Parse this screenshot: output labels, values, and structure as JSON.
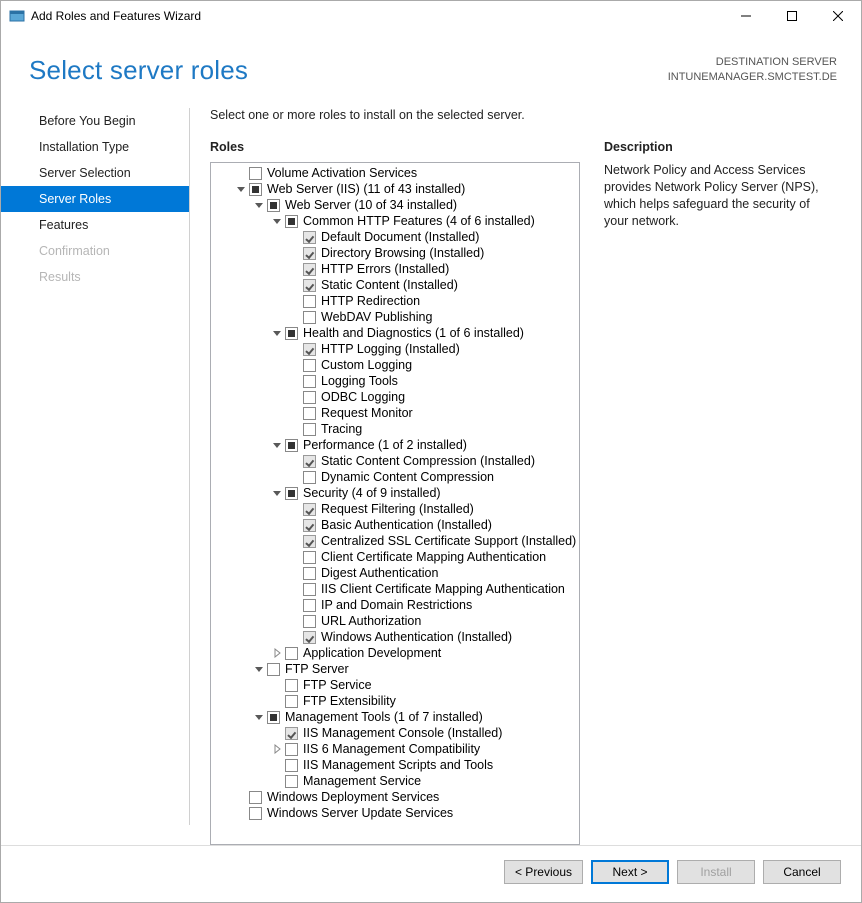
{
  "window": {
    "title": "Add Roles and Features Wizard"
  },
  "header": {
    "page_title": "Select server roles",
    "dest_label": "DESTINATION SERVER",
    "dest_value": "INTUNEMANAGER.SMCTEST.DE"
  },
  "nav": {
    "items": [
      {
        "label": "Before You Begin",
        "state": "normal"
      },
      {
        "label": "Installation Type",
        "state": "normal"
      },
      {
        "label": "Server Selection",
        "state": "normal"
      },
      {
        "label": "Server Roles",
        "state": "selected"
      },
      {
        "label": "Features",
        "state": "normal"
      },
      {
        "label": "Confirmation",
        "state": "disabled"
      },
      {
        "label": "Results",
        "state": "disabled"
      }
    ]
  },
  "content": {
    "instruction": "Select one or more roles to install on the selected server.",
    "roles_label": "Roles",
    "desc_label": "Description",
    "desc_text": "Network Policy and Access Services provides Network Policy Server (NPS), which helps safeguard the security of your network."
  },
  "tree": [
    {
      "d": 1,
      "t": "none",
      "c": "unchecked",
      "l": "Volume Activation Services"
    },
    {
      "d": 1,
      "t": "open",
      "c": "partial",
      "l": "Web Server (IIS) (11 of 43 installed)"
    },
    {
      "d": 2,
      "t": "open",
      "c": "partial",
      "l": "Web Server (10 of 34 installed)"
    },
    {
      "d": 3,
      "t": "open",
      "c": "partial",
      "l": "Common HTTP Features (4 of 6 installed)"
    },
    {
      "d": 4,
      "t": "none",
      "c": "checked",
      "l": "Default Document (Installed)"
    },
    {
      "d": 4,
      "t": "none",
      "c": "checked",
      "l": "Directory Browsing (Installed)"
    },
    {
      "d": 4,
      "t": "none",
      "c": "checked",
      "l": "HTTP Errors (Installed)"
    },
    {
      "d": 4,
      "t": "none",
      "c": "checked",
      "l": "Static Content (Installed)"
    },
    {
      "d": 4,
      "t": "none",
      "c": "unchecked",
      "l": "HTTP Redirection"
    },
    {
      "d": 4,
      "t": "none",
      "c": "unchecked",
      "l": "WebDAV Publishing"
    },
    {
      "d": 3,
      "t": "open",
      "c": "partial",
      "l": "Health and Diagnostics (1 of 6 installed)"
    },
    {
      "d": 4,
      "t": "none",
      "c": "checked",
      "l": "HTTP Logging (Installed)"
    },
    {
      "d": 4,
      "t": "none",
      "c": "unchecked",
      "l": "Custom Logging"
    },
    {
      "d": 4,
      "t": "none",
      "c": "unchecked",
      "l": "Logging Tools"
    },
    {
      "d": 4,
      "t": "none",
      "c": "unchecked",
      "l": "ODBC Logging"
    },
    {
      "d": 4,
      "t": "none",
      "c": "unchecked",
      "l": "Request Monitor"
    },
    {
      "d": 4,
      "t": "none",
      "c": "unchecked",
      "l": "Tracing"
    },
    {
      "d": 3,
      "t": "open",
      "c": "partial",
      "l": "Performance (1 of 2 installed)"
    },
    {
      "d": 4,
      "t": "none",
      "c": "checked",
      "l": "Static Content Compression (Installed)"
    },
    {
      "d": 4,
      "t": "none",
      "c": "unchecked",
      "l": "Dynamic Content Compression"
    },
    {
      "d": 3,
      "t": "open",
      "c": "partial",
      "l": "Security (4 of 9 installed)"
    },
    {
      "d": 4,
      "t": "none",
      "c": "checked",
      "l": "Request Filtering (Installed)"
    },
    {
      "d": 4,
      "t": "none",
      "c": "checked",
      "l": "Basic Authentication (Installed)"
    },
    {
      "d": 4,
      "t": "none",
      "c": "checked",
      "l": "Centralized SSL Certificate Support (Installed)"
    },
    {
      "d": 4,
      "t": "none",
      "c": "unchecked",
      "l": "Client Certificate Mapping Authentication"
    },
    {
      "d": 4,
      "t": "none",
      "c": "unchecked",
      "l": "Digest Authentication"
    },
    {
      "d": 4,
      "t": "none",
      "c": "unchecked",
      "l": "IIS Client Certificate Mapping Authentication"
    },
    {
      "d": 4,
      "t": "none",
      "c": "unchecked",
      "l": "IP and Domain Restrictions"
    },
    {
      "d": 4,
      "t": "none",
      "c": "unchecked",
      "l": "URL Authorization"
    },
    {
      "d": 4,
      "t": "none",
      "c": "checked",
      "l": "Windows Authentication (Installed)"
    },
    {
      "d": 3,
      "t": "closed",
      "c": "unchecked",
      "l": "Application Development"
    },
    {
      "d": 2,
      "t": "open",
      "c": "unchecked",
      "l": "FTP Server"
    },
    {
      "d": 3,
      "t": "none",
      "c": "unchecked",
      "l": "FTP Service"
    },
    {
      "d": 3,
      "t": "none",
      "c": "unchecked",
      "l": "FTP Extensibility"
    },
    {
      "d": 2,
      "t": "open",
      "c": "partial",
      "l": "Management Tools (1 of 7 installed)"
    },
    {
      "d": 3,
      "t": "none",
      "c": "checked",
      "l": "IIS Management Console (Installed)"
    },
    {
      "d": 3,
      "t": "closed",
      "c": "unchecked",
      "l": "IIS 6 Management Compatibility"
    },
    {
      "d": 3,
      "t": "none",
      "c": "unchecked",
      "l": "IIS Management Scripts and Tools"
    },
    {
      "d": 3,
      "t": "none",
      "c": "unchecked",
      "l": "Management Service"
    },
    {
      "d": 1,
      "t": "none",
      "c": "unchecked",
      "l": "Windows Deployment Services"
    },
    {
      "d": 1,
      "t": "none",
      "c": "unchecked",
      "l": "Windows Server Update Services"
    }
  ],
  "footer": {
    "previous": "< Previous",
    "next": "Next >",
    "install": "Install",
    "cancel": "Cancel"
  }
}
